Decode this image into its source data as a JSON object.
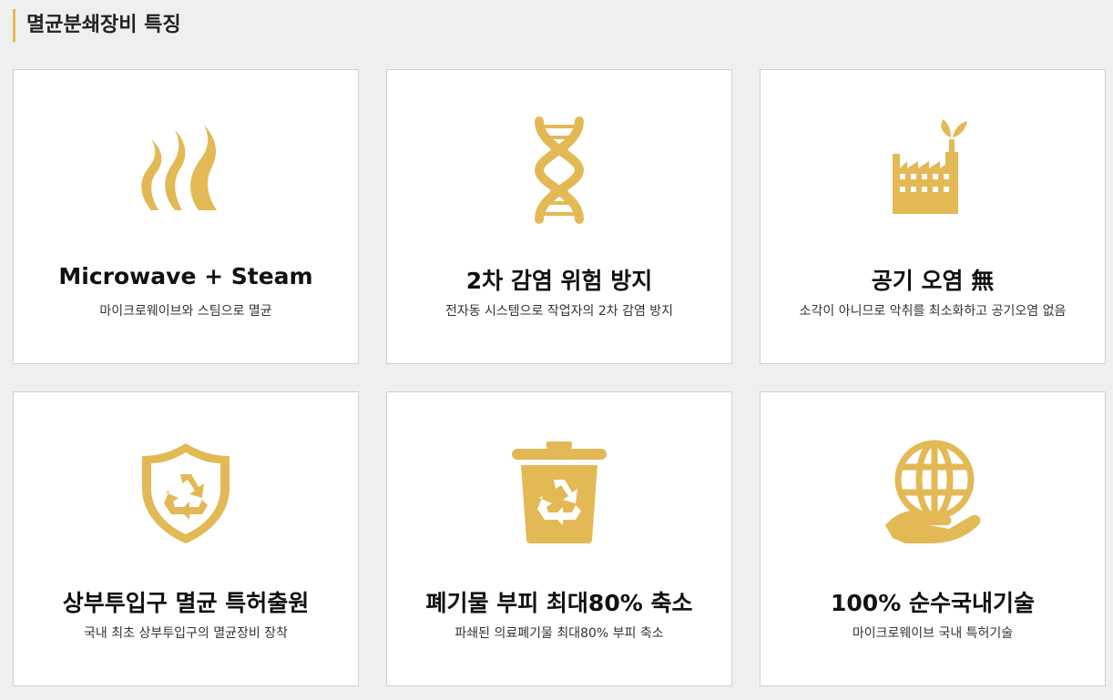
{
  "section": {
    "title": "멸균분쇄장비 특징"
  },
  "colors": {
    "accent": "#e2b955",
    "background": "#efefef",
    "card": "#ffffff",
    "border": "#d0d0d0"
  },
  "cards": [
    {
      "icon": "steam-icon",
      "title": "Microwave + Steam",
      "desc": "마이크로웨이브와 스팀으로 멸균"
    },
    {
      "icon": "dna-icon",
      "title": "2차 감염 위험 방지",
      "desc": "전자동 시스템으로 작업자의 2차 감염 방지"
    },
    {
      "icon": "eco-factory-icon",
      "title": "공기 오염 無",
      "desc": "소각이 아니므로 악취를 최소화하고 공기오염 없음"
    },
    {
      "icon": "recycle-shield-icon",
      "title": "상부투입구 멸균 특허출원",
      "desc": "국내 최초 상부투입구의 멸균장비 장착"
    },
    {
      "icon": "recycle-bin-icon",
      "title": "폐기물 부피 최대80% 축소",
      "desc": "파쇄된 의료폐기물 최대80% 부피 축소"
    },
    {
      "icon": "globe-hand-icon",
      "title": "100% 순수국내기술",
      "desc": "마이크로웨이브 국내 특허기술"
    }
  ]
}
